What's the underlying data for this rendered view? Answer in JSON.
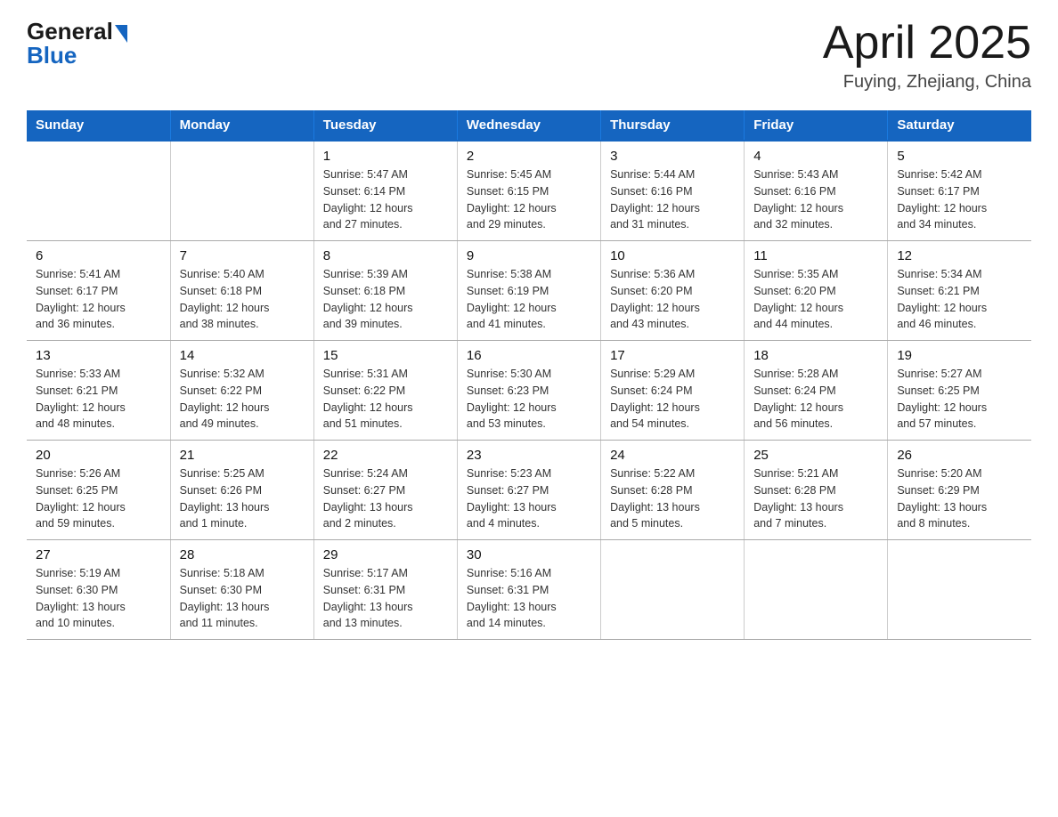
{
  "header": {
    "logo_general": "General",
    "logo_blue": "Blue",
    "month_year": "April 2025",
    "location": "Fuying, Zhejiang, China"
  },
  "days_of_week": [
    "Sunday",
    "Monday",
    "Tuesday",
    "Wednesday",
    "Thursday",
    "Friday",
    "Saturday"
  ],
  "weeks": [
    [
      {
        "day": "",
        "info": ""
      },
      {
        "day": "",
        "info": ""
      },
      {
        "day": "1",
        "info": "Sunrise: 5:47 AM\nSunset: 6:14 PM\nDaylight: 12 hours\nand 27 minutes."
      },
      {
        "day": "2",
        "info": "Sunrise: 5:45 AM\nSunset: 6:15 PM\nDaylight: 12 hours\nand 29 minutes."
      },
      {
        "day": "3",
        "info": "Sunrise: 5:44 AM\nSunset: 6:16 PM\nDaylight: 12 hours\nand 31 minutes."
      },
      {
        "day": "4",
        "info": "Sunrise: 5:43 AM\nSunset: 6:16 PM\nDaylight: 12 hours\nand 32 minutes."
      },
      {
        "day": "5",
        "info": "Sunrise: 5:42 AM\nSunset: 6:17 PM\nDaylight: 12 hours\nand 34 minutes."
      }
    ],
    [
      {
        "day": "6",
        "info": "Sunrise: 5:41 AM\nSunset: 6:17 PM\nDaylight: 12 hours\nand 36 minutes."
      },
      {
        "day": "7",
        "info": "Sunrise: 5:40 AM\nSunset: 6:18 PM\nDaylight: 12 hours\nand 38 minutes."
      },
      {
        "day": "8",
        "info": "Sunrise: 5:39 AM\nSunset: 6:18 PM\nDaylight: 12 hours\nand 39 minutes."
      },
      {
        "day": "9",
        "info": "Sunrise: 5:38 AM\nSunset: 6:19 PM\nDaylight: 12 hours\nand 41 minutes."
      },
      {
        "day": "10",
        "info": "Sunrise: 5:36 AM\nSunset: 6:20 PM\nDaylight: 12 hours\nand 43 minutes."
      },
      {
        "day": "11",
        "info": "Sunrise: 5:35 AM\nSunset: 6:20 PM\nDaylight: 12 hours\nand 44 minutes."
      },
      {
        "day": "12",
        "info": "Sunrise: 5:34 AM\nSunset: 6:21 PM\nDaylight: 12 hours\nand 46 minutes."
      }
    ],
    [
      {
        "day": "13",
        "info": "Sunrise: 5:33 AM\nSunset: 6:21 PM\nDaylight: 12 hours\nand 48 minutes."
      },
      {
        "day": "14",
        "info": "Sunrise: 5:32 AM\nSunset: 6:22 PM\nDaylight: 12 hours\nand 49 minutes."
      },
      {
        "day": "15",
        "info": "Sunrise: 5:31 AM\nSunset: 6:22 PM\nDaylight: 12 hours\nand 51 minutes."
      },
      {
        "day": "16",
        "info": "Sunrise: 5:30 AM\nSunset: 6:23 PM\nDaylight: 12 hours\nand 53 minutes."
      },
      {
        "day": "17",
        "info": "Sunrise: 5:29 AM\nSunset: 6:24 PM\nDaylight: 12 hours\nand 54 minutes."
      },
      {
        "day": "18",
        "info": "Sunrise: 5:28 AM\nSunset: 6:24 PM\nDaylight: 12 hours\nand 56 minutes."
      },
      {
        "day": "19",
        "info": "Sunrise: 5:27 AM\nSunset: 6:25 PM\nDaylight: 12 hours\nand 57 minutes."
      }
    ],
    [
      {
        "day": "20",
        "info": "Sunrise: 5:26 AM\nSunset: 6:25 PM\nDaylight: 12 hours\nand 59 minutes."
      },
      {
        "day": "21",
        "info": "Sunrise: 5:25 AM\nSunset: 6:26 PM\nDaylight: 13 hours\nand 1 minute."
      },
      {
        "day": "22",
        "info": "Sunrise: 5:24 AM\nSunset: 6:27 PM\nDaylight: 13 hours\nand 2 minutes."
      },
      {
        "day": "23",
        "info": "Sunrise: 5:23 AM\nSunset: 6:27 PM\nDaylight: 13 hours\nand 4 minutes."
      },
      {
        "day": "24",
        "info": "Sunrise: 5:22 AM\nSunset: 6:28 PM\nDaylight: 13 hours\nand 5 minutes."
      },
      {
        "day": "25",
        "info": "Sunrise: 5:21 AM\nSunset: 6:28 PM\nDaylight: 13 hours\nand 7 minutes."
      },
      {
        "day": "26",
        "info": "Sunrise: 5:20 AM\nSunset: 6:29 PM\nDaylight: 13 hours\nand 8 minutes."
      }
    ],
    [
      {
        "day": "27",
        "info": "Sunrise: 5:19 AM\nSunset: 6:30 PM\nDaylight: 13 hours\nand 10 minutes."
      },
      {
        "day": "28",
        "info": "Sunrise: 5:18 AM\nSunset: 6:30 PM\nDaylight: 13 hours\nand 11 minutes."
      },
      {
        "day": "29",
        "info": "Sunrise: 5:17 AM\nSunset: 6:31 PM\nDaylight: 13 hours\nand 13 minutes."
      },
      {
        "day": "30",
        "info": "Sunrise: 5:16 AM\nSunset: 6:31 PM\nDaylight: 13 hours\nand 14 minutes."
      },
      {
        "day": "",
        "info": ""
      },
      {
        "day": "",
        "info": ""
      },
      {
        "day": "",
        "info": ""
      }
    ]
  ]
}
